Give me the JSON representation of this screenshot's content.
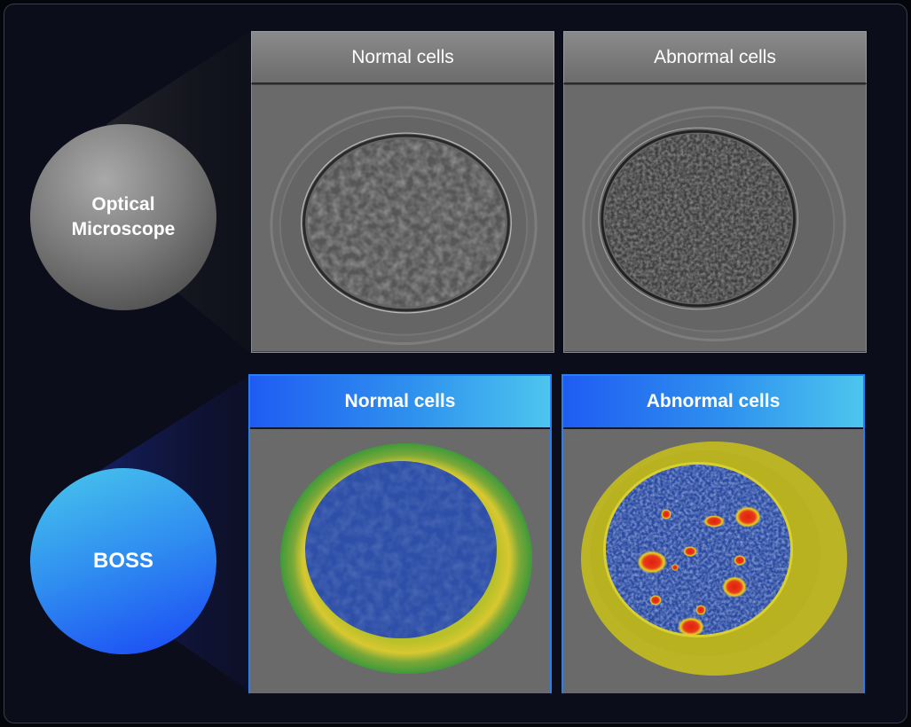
{
  "circles": {
    "optical_line1": "Optical",
    "optical_line2": "Microscope",
    "boss": "BOSS"
  },
  "optical_row": {
    "normal_label": "Normal cells",
    "abnormal_label": "Abnormal cells"
  },
  "boss_row": {
    "normal_label": "Normal cells",
    "abnormal_label": "Abnormal cells"
  },
  "colors": {
    "background": "#0b0d1a",
    "boss_accent": "#2a7ff0",
    "normal_ring": "#3f9a3a",
    "abnormal_ring": "#c9c21a",
    "cytoplasm": "#2e4fa8",
    "hotspot": "#e02010"
  }
}
